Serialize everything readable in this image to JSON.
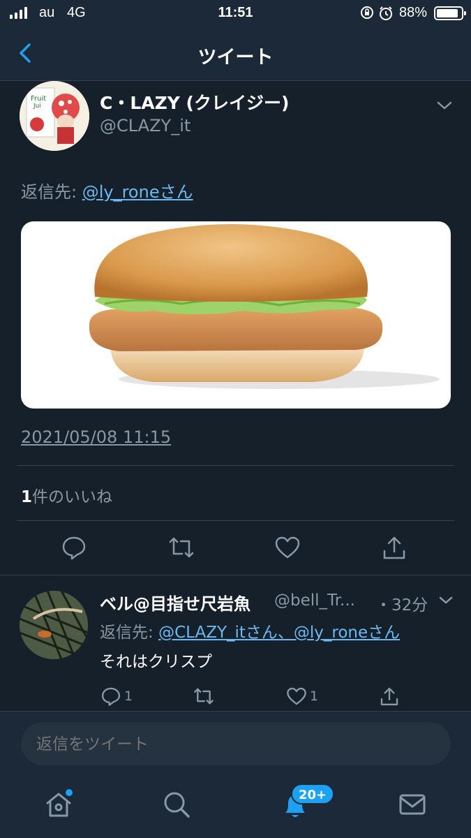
{
  "status_bar": {
    "carrier": "au",
    "network": "4G",
    "time": "11:51",
    "battery": "88%",
    "battery_level": 0.88
  },
  "nav": {
    "title": "ツイート",
    "back_icon": "chevron-left-icon"
  },
  "tweet": {
    "author_name": "C・LAZY (クレイジー)",
    "author_handle": "@CLAZY_it",
    "avatar_text": "Fruit Jui",
    "reply_to_label": "返信先: ",
    "reply_to_user": "@ly_roneさん",
    "timestamp": "2021/05/08 11:15",
    "likes_count": "1",
    "likes_label": "件のいいね",
    "actions": [
      "reply-icon",
      "retweet-icon",
      "like-icon",
      "share-icon"
    ]
  },
  "reply": {
    "name": "ベル@目指せ尺岩魚",
    "handle": "@bell_Tr...",
    "time": "・32分",
    "reply_to_label": "返信先: ",
    "reply_to_users": "@CLAZY_itさん、@ly_roneさん",
    "text": "それはクリスプ",
    "reply_count": "1",
    "like_count": "1"
  },
  "compose": {
    "placeholder": "返信をツイート"
  },
  "tab_bar": {
    "notifications_badge": "20+",
    "tabs": [
      "home-icon",
      "search-icon",
      "notifications-icon",
      "messages-icon"
    ]
  },
  "colors": {
    "background": "#15202b",
    "bar": "#1c2938",
    "accent": "#1da1f2",
    "secondary_text": "#8899a6"
  }
}
